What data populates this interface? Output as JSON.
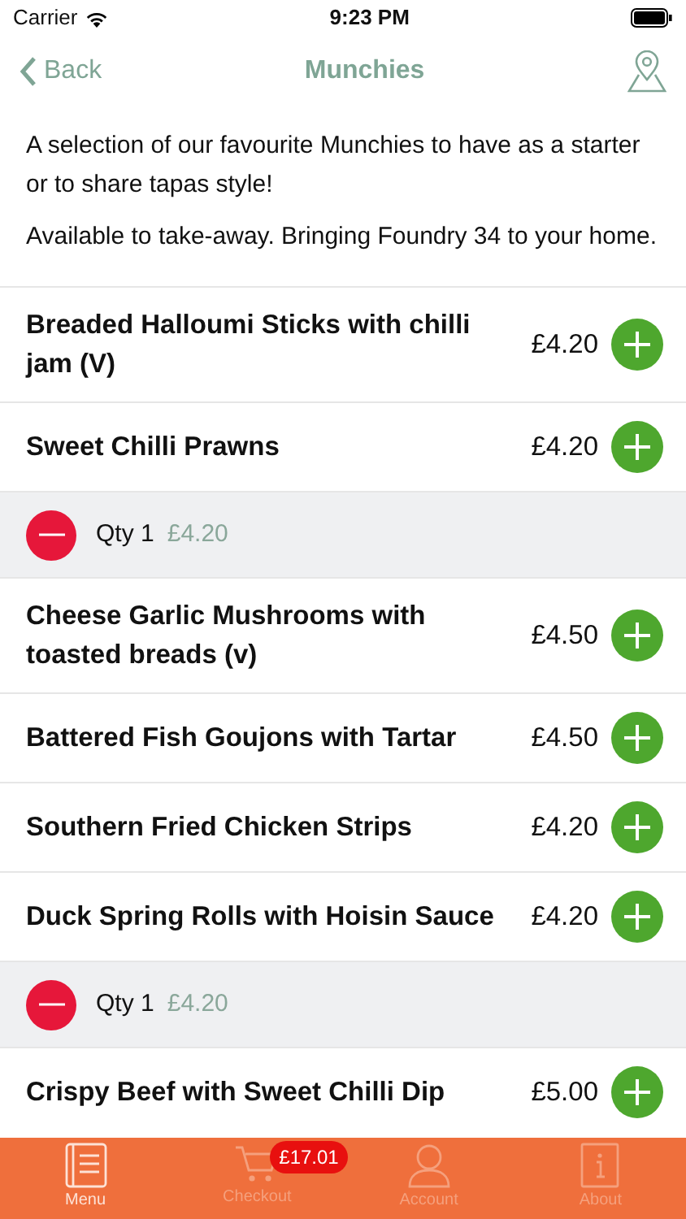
{
  "status_bar": {
    "carrier": "Carrier",
    "time": "9:23 PM"
  },
  "nav": {
    "back": "Back",
    "title": "Munchies"
  },
  "intro": [
    "A selection of our favourite Munchies to have as a starter or to share tapas style!",
    "Available to take-away. Bringing Foundry 34 to your home."
  ],
  "items": [
    {
      "kind": "dish",
      "name": "Breaded Halloumi Sticks with chilli jam (V)",
      "price": "£4.20"
    },
    {
      "kind": "dish",
      "name": "Sweet Chilli Prawns",
      "price": "£4.20"
    },
    {
      "kind": "quantity",
      "qty": "Qty 1",
      "price": "£4.20"
    },
    {
      "kind": "dish",
      "name": "Cheese Garlic Mushrooms with toasted breads  (v)",
      "price": "£4.50"
    },
    {
      "kind": "dish",
      "name": "Battered Fish Goujons with Tartar",
      "price": "£4.50"
    },
    {
      "kind": "dish",
      "name": "Southern Fried Chicken Strips",
      "price": "£4.20"
    },
    {
      "kind": "dish",
      "name": "Duck Spring Rolls with Hoisin Sauce",
      "price": "£4.20"
    },
    {
      "kind": "quantity",
      "qty": "Qty 1",
      "price": "£4.20"
    },
    {
      "kind": "dish",
      "name": "Crispy Beef with Sweet Chilli Dip",
      "price": "£5.00"
    }
  ],
  "tabs": [
    {
      "kind": "menu",
      "label": "Menu",
      "selected": true
    },
    {
      "kind": "checkout",
      "label": "Checkout",
      "selected": false,
      "badge": "£17.01"
    },
    {
      "kind": "account",
      "label": "Account",
      "selected": false
    },
    {
      "kind": "about",
      "label": "About",
      "selected": false
    }
  ]
}
